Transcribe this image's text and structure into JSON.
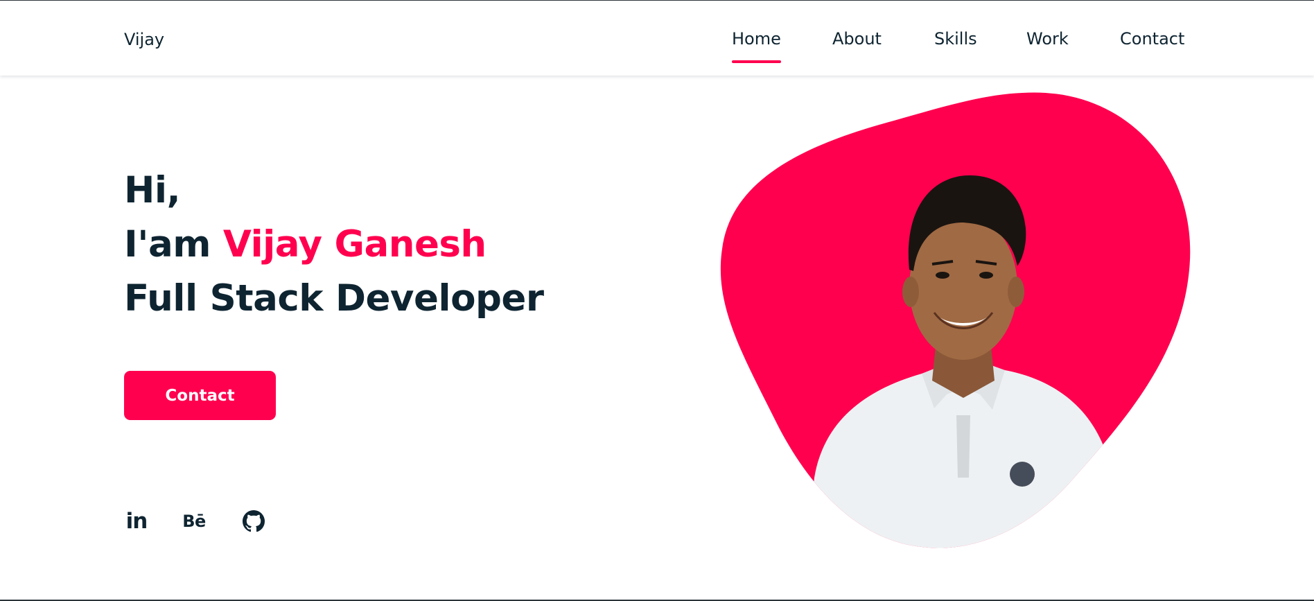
{
  "header": {
    "logo": "Vijay",
    "nav": [
      {
        "label": "Home",
        "active": true
      },
      {
        "label": "About",
        "active": false
      },
      {
        "label": "Skills",
        "active": false
      },
      {
        "label": "Work",
        "active": false
      },
      {
        "label": "Contact",
        "active": false
      }
    ]
  },
  "hero": {
    "greeting": "Hi,",
    "intro_prefix": "I'am",
    "name": "Vijay Ganesh",
    "title": "Full Stack Developer",
    "contact_button": "Contact"
  },
  "social": {
    "linkedin": "in",
    "behance": "Bē",
    "github_icon": "github-icon"
  },
  "colors": {
    "accent": "#ff004f",
    "text": "#0e2431",
    "background": "#ffffff"
  }
}
